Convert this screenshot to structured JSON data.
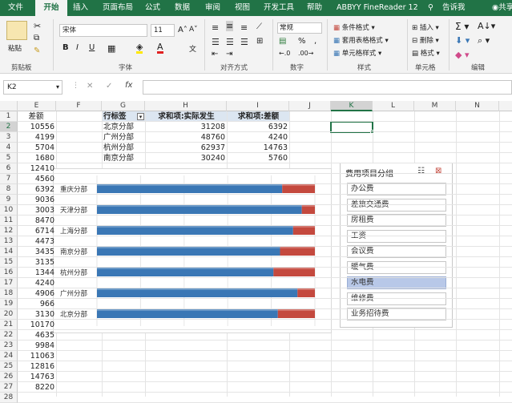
{
  "tabs": [
    "文件",
    "开始",
    "插入",
    "页面布局",
    "公式",
    "数据",
    "审阅",
    "视图",
    "开发工具",
    "帮助",
    "ABBYY FineReader 12",
    "告诉我",
    "共享"
  ],
  "ribbon": {
    "clipboard": {
      "paste": "粘贴",
      "label": "剪贴板"
    },
    "font": {
      "name": "宋体",
      "size": "11",
      "label": "字体",
      "bold": "B",
      "italic": "I",
      "underline": "U",
      "fontcolor": "A",
      "grow": "A˄",
      "shrink": "A˅"
    },
    "align": {
      "label": "对齐方式"
    },
    "number": {
      "format": "常规",
      "label": "数字",
      "percent": "%",
      "comma": ","
    },
    "styles": {
      "conditional": "条件格式",
      "table": "套用表格格式",
      "cell": "单元格样式",
      "label": "样式"
    },
    "cells": {
      "insert": "插入",
      "delete": "删除",
      "format": "格式",
      "label": "单元格"
    },
    "editing": {
      "label": "编辑"
    }
  },
  "formula": {
    "namebox": "K2",
    "fx": "fx",
    "content": ""
  },
  "columns": [
    "E",
    "F",
    "G",
    "H",
    "I",
    "J",
    "K",
    "L",
    "M",
    "N"
  ],
  "rows": [
    "1",
    "2",
    "3",
    "4",
    "5",
    "6",
    "7",
    "8",
    "9",
    "10",
    "11",
    "12",
    "13",
    "14",
    "15",
    "16",
    "17",
    "18",
    "19",
    "20",
    "21",
    "22",
    "23",
    "24",
    "25",
    "26",
    "27",
    "28"
  ],
  "colE": [
    "差额",
    "10556",
    "4199",
    "5704",
    "1680",
    "12410",
    "4560",
    "6392",
    "9036",
    "3003",
    "8470",
    "6714",
    "4473",
    "3435",
    "3135",
    "1344",
    "4240",
    "4906",
    "966",
    "3130",
    "10170",
    "4635",
    "9984",
    "11063",
    "12816",
    "14763",
    "8220",
    ""
  ],
  "pivot": {
    "headers": [
      "行标签",
      "求和项:实际发生",
      "求和项:差额"
    ],
    "rows": [
      [
        "北京分部",
        "31208",
        "6392"
      ],
      [
        "广州分部",
        "48760",
        "4240"
      ],
      [
        "杭州分部",
        "62937",
        "14763"
      ],
      [
        "南京分部",
        "30240",
        "5760"
      ]
    ]
  },
  "chart_data": {
    "type": "bar",
    "orientation": "horizontal",
    "stacked": "100%",
    "categories": [
      "重庆分部",
      "天津分部",
      "上海分部",
      "南京分部",
      "杭州分部",
      "广州分部",
      "北京分部"
    ],
    "series": [
      {
        "values": [
          85,
          94,
          90,
          84,
          81,
          92,
          83
        ],
        "color": "#3a77b5"
      },
      {
        "values": [
          15,
          6,
          10,
          16,
          19,
          8,
          17
        ],
        "color": "#c4493e"
      }
    ],
    "xlim": [
      0,
      100
    ],
    "grid": true
  },
  "slicer": {
    "title": "费用项目分组",
    "items": [
      "办公费",
      "差旅交通费",
      "房租费",
      "工资",
      "会议费",
      "暖气费",
      "水电费",
      "维修费",
      "业务招待费"
    ],
    "selected": "水电费"
  },
  "colors": {
    "excel_green": "#217346",
    "series_blue": "#3a77b5",
    "series_red": "#c4493e",
    "slicer_selected": "#b8c8e8"
  }
}
